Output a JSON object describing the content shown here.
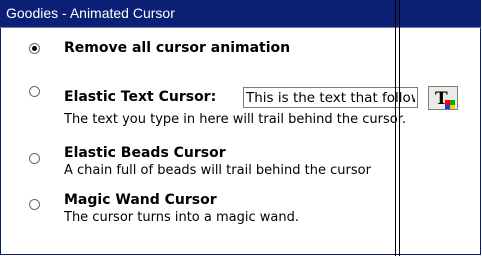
{
  "panel": {
    "title": "Goodies - Animated Cursor",
    "colors": {
      "titlebar": "#0b1f75",
      "border": "#0b1f75"
    }
  },
  "options": [
    {
      "title": "Remove all cursor animation",
      "description": "",
      "selected": true
    },
    {
      "title": "Elastic Text Cursor:",
      "description": "The text you type in here will trail behind the cursor.",
      "selected": false
    },
    {
      "title": "Elastic Beads Cursor",
      "description": "A chain full of beads will trail behind the cursor",
      "selected": false
    },
    {
      "title": "Magic Wand Cursor",
      "description": "The cursor turns into a magic wand.",
      "selected": false
    }
  ],
  "elastic_text": {
    "value": "This is the text that follows"
  },
  "font_button": {
    "icon": "font-picker-icon"
  }
}
